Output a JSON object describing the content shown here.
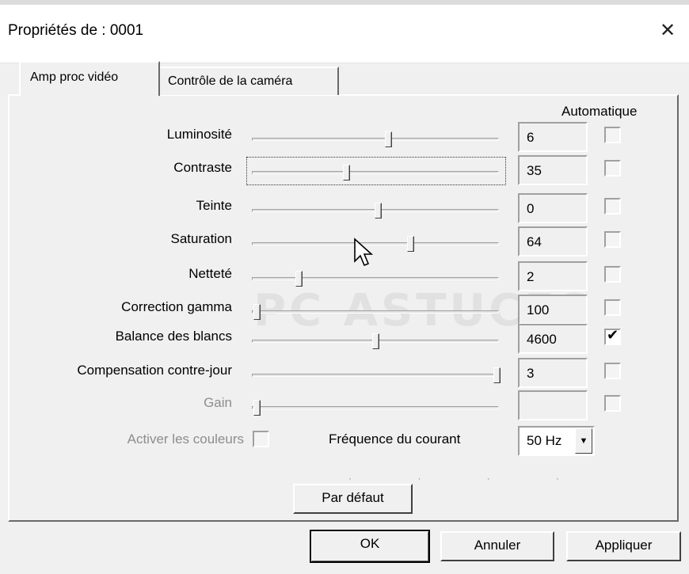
{
  "window": {
    "title": "Propriétés de : 0001",
    "close_glyph": "✕"
  },
  "tabs": [
    {
      "label": "Amp proc vidéo",
      "active": true
    },
    {
      "label": "Contrôle de la caméra",
      "active": false
    }
  ],
  "auto_header": "Automatique",
  "controls": [
    {
      "label": "Luminosité",
      "value": "6",
      "slider_pct": 0.55,
      "auto": false,
      "disabled": false
    },
    {
      "label": "Contraste",
      "value": "35",
      "slider_pct": 0.38,
      "auto": false,
      "disabled": false,
      "focused": true
    },
    {
      "label": "Teinte",
      "value": "0",
      "slider_pct": 0.51,
      "auto": false,
      "disabled": false
    },
    {
      "label": "Saturation",
      "value": "64",
      "slider_pct": 0.64,
      "auto": false,
      "disabled": false
    },
    {
      "label": "Netteté",
      "value": "2",
      "slider_pct": 0.19,
      "auto": false,
      "disabled": false
    },
    {
      "label": "Correction gamma",
      "value": "100",
      "slider_pct": 0.02,
      "auto": false,
      "disabled": false
    },
    {
      "label": "Balance des blancs",
      "value": "4600",
      "slider_pct": 0.5,
      "auto": true,
      "disabled": false
    },
    {
      "label": "Compensation contre-jour",
      "value": "3",
      "slider_pct": 0.99,
      "auto": false,
      "disabled": false
    },
    {
      "label": "Gain",
      "value": "",
      "slider_pct": 0.02,
      "auto": false,
      "disabled": true
    }
  ],
  "enable_colors": {
    "label": "Activer les couleurs",
    "checked": false,
    "disabled": true
  },
  "frequency": {
    "label": "Fréquence du courant",
    "value": "50 Hz"
  },
  "buttons": {
    "default": "Par défaut",
    "ok": "OK",
    "cancel": "Annuler",
    "apply": "Appliquer"
  },
  "watermark": "PC ASTUCES"
}
